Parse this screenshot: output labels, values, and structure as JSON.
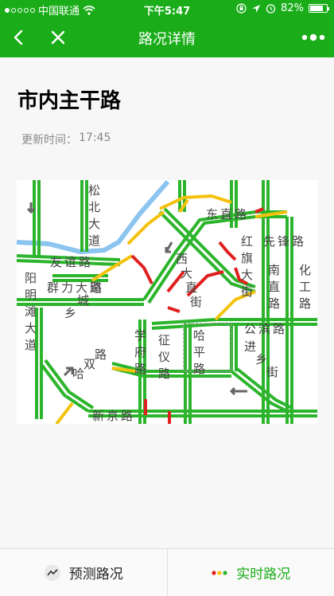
{
  "status": {
    "carrier": "中国联通",
    "time": "下午5:47",
    "battery": "82%",
    "battery_level": 0.82
  },
  "nav": {
    "title": "路况详情"
  },
  "page": {
    "title": "市内主干路",
    "update_label": "更新时间：",
    "update_time": "17:45"
  },
  "map": {
    "labels": [
      "松北大道",
      "东直路",
      "红旗大街",
      "先锋路",
      "南直路",
      "化工路",
      "友谊路",
      "群力大道",
      "阳明滩大道",
      "西大直街",
      "乡城路",
      "学府路",
      "征仪路",
      "哈平路",
      "公滨路",
      "进乡街",
      "哈双路",
      "新京路"
    ],
    "colors": {
      "green": "#2cb52c",
      "yellow": "#f4c20d",
      "red": "#e02020",
      "river": "#8cc4f0"
    }
  },
  "tabs": [
    {
      "label": "预测路况",
      "active": false
    },
    {
      "label": "实时路况",
      "active": true
    }
  ],
  "colors": {
    "brand": "#1aad19"
  }
}
